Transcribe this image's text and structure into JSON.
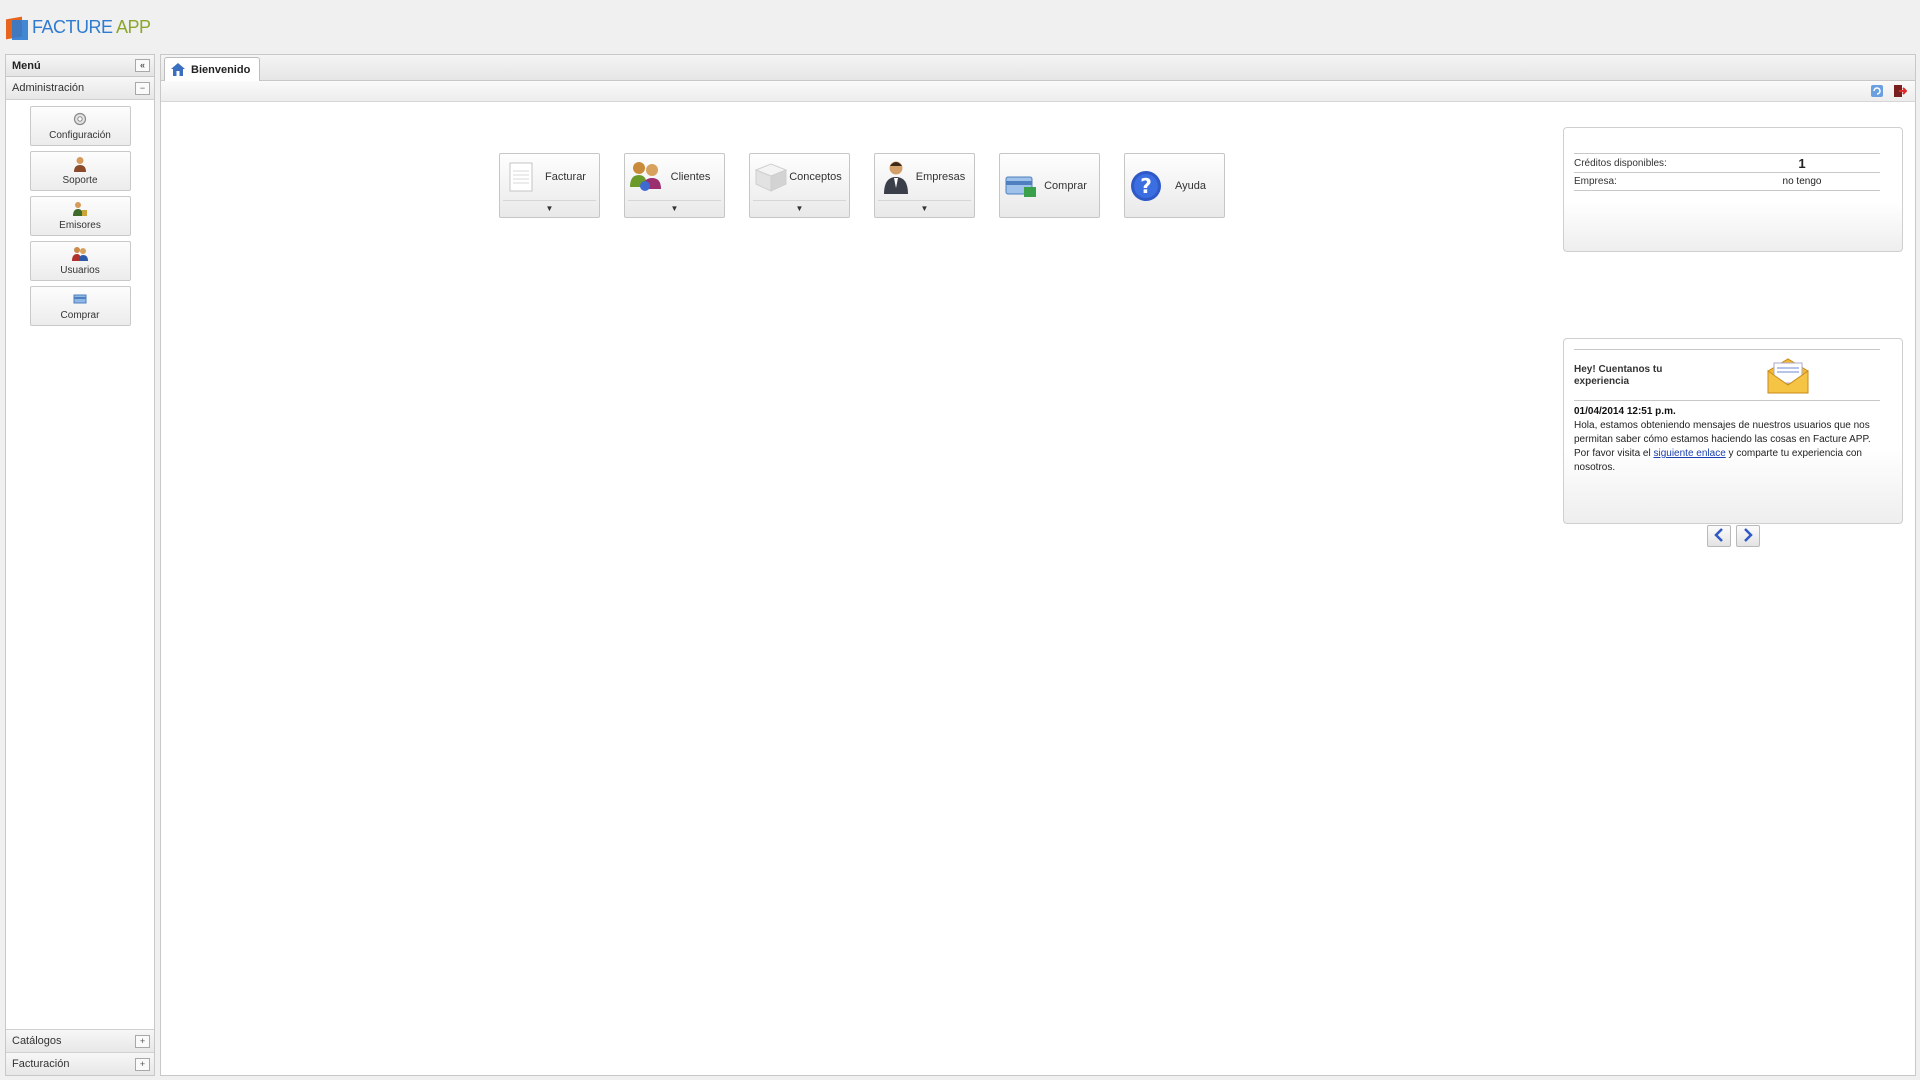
{
  "app": {
    "name_part1": "FACTURE",
    "name_part2": " APP"
  },
  "sidebar": {
    "title": "Menú",
    "sections": {
      "administracion": "Administración",
      "catalogos": "Catálogos",
      "facturacion": "Facturación"
    },
    "items": [
      {
        "label": "Configuración",
        "icon": "gear-icon"
      },
      {
        "label": "Soporte",
        "icon": "support-agent-icon"
      },
      {
        "label": "Emisores",
        "icon": "issuers-icon"
      },
      {
        "label": "Usuarios",
        "icon": "users-icon"
      },
      {
        "label": "Comprar",
        "icon": "purchase-icon"
      }
    ]
  },
  "tabs": [
    {
      "label": "Bienvenido",
      "icon": "home-icon"
    }
  ],
  "toolbar": {
    "icons": [
      "refresh-icon",
      "logout-icon"
    ]
  },
  "quick_buttons": [
    {
      "label": "Facturar",
      "icon": "invoice-icon",
      "has_menu": true
    },
    {
      "label": "Clientes",
      "icon": "clients-icon",
      "has_menu": true
    },
    {
      "label": "Conceptos",
      "icon": "box-icon",
      "has_menu": true
    },
    {
      "label": "Empresas",
      "icon": "businessman-icon",
      "has_menu": true
    },
    {
      "label": "Comprar",
      "icon": "purchase-icon",
      "has_menu": false
    },
    {
      "label": "Ayuda",
      "icon": "help-icon",
      "has_menu": false
    }
  ],
  "credits": {
    "rows": [
      {
        "key": "Créditos disponibles:",
        "value": "1"
      },
      {
        "key": "Empresa:",
        "value": "no tengo"
      }
    ]
  },
  "news": {
    "title": "Hey! Cuentanos tu experiencia",
    "date": "01/04/2014 12:51 p.m.",
    "body_before": "Hola, estamos obteniendo mensajes de nuestros usuarios que nos permitan saber cómo estamos haciendo las cosas en Facture APP. Por favor visita el ",
    "link_text": "siguiente enlace",
    "body_after": " y comparte tu experiencia con nosotros."
  },
  "colors": {
    "brand_blue": "#2f7bd0",
    "brand_green": "#8aa62c",
    "brand_orange": "#e8641c"
  }
}
